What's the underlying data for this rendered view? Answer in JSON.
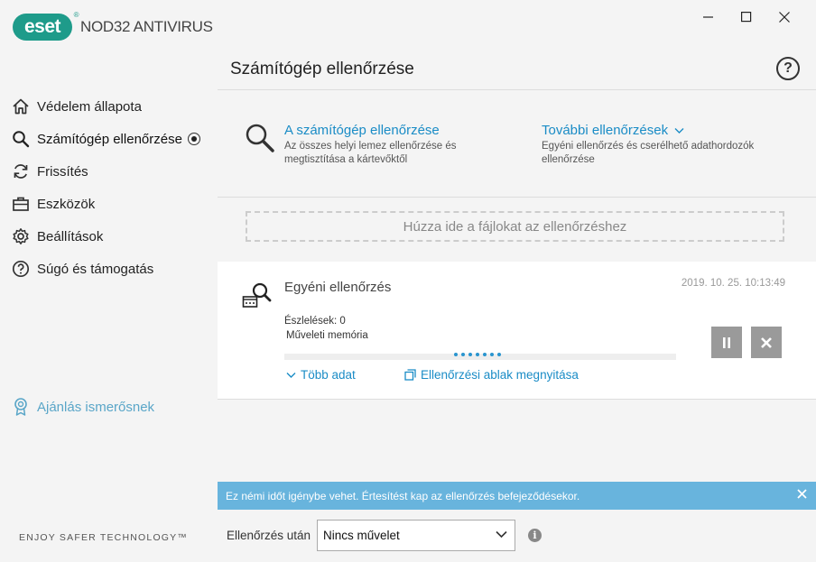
{
  "brand": {
    "logo_text": "eset",
    "product": "NOD32 ANTIVIRUS",
    "tagline": "ENJOY SAFER TECHNOLOGY™"
  },
  "sidebar": {
    "items": [
      {
        "label": "Védelem állapota",
        "icon": "home-icon"
      },
      {
        "label": "Számítógép ellenőrzése",
        "icon": "search-icon",
        "active": true
      },
      {
        "label": "Frissítés",
        "icon": "refresh-icon"
      },
      {
        "label": "Eszközök",
        "icon": "briefcase-icon"
      },
      {
        "label": "Beállítások",
        "icon": "gear-icon"
      },
      {
        "label": "Súgó és támogatás",
        "icon": "help-icon"
      }
    ],
    "refer": "Ajánlás ismerősnek"
  },
  "header": {
    "title": "Számítógép ellenőrzése"
  },
  "options": {
    "scan_computer_title": "A számítógép ellenőrzése",
    "scan_computer_desc": "Az összes helyi lemez ellenőrzése és megtisztítása a kártevőktől",
    "advanced_title": "További ellenőrzések",
    "advanced_desc": "Egyéni ellenőrzés és cserélhető adathordozók ellenőrzése"
  },
  "dropzone": "Húzza ide a fájlokat az ellenőrzéshez",
  "scan": {
    "name": "Egyéni ellenőrzés",
    "timestamp": "2019. 10. 25. 10:13:49",
    "detections": "Észlelések: 0",
    "object": "Műveleti memória",
    "more": "Több adat",
    "open_window": "Ellenőrzési ablak megnyitása"
  },
  "notification": "Ez némi időt igénybe vehet. Értesítést kap az ellenőrzés befejeződésekor.",
  "after_scan": {
    "label": "Ellenőrzés után",
    "selected": "Nincs művelet"
  },
  "colors": {
    "accent": "#1a8cc6",
    "brand": "#1e9b8a",
    "notify": "#68b4dd"
  }
}
